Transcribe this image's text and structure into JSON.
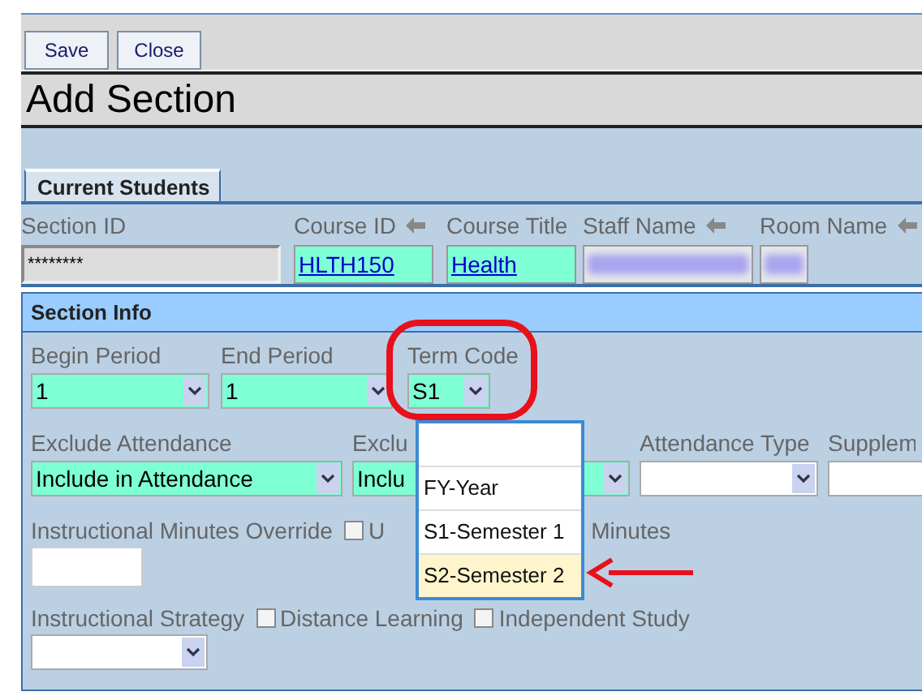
{
  "toolbar": {
    "buttons": [
      "Save",
      "Close"
    ]
  },
  "title": "Add Section",
  "tabs": [
    {
      "label": "Current Students",
      "selected": true
    }
  ],
  "header_fields": [
    {
      "label": "Section ID",
      "kind": "text",
      "value": "********",
      "arrow": false
    },
    {
      "label": "Course ID",
      "kind": "link",
      "value": "HLTH150",
      "arrow": true
    },
    {
      "label": "Course Title",
      "kind": "link",
      "value": "Health",
      "arrow": false
    },
    {
      "label": "Staff Name",
      "kind": "blurred",
      "arrow": true
    },
    {
      "label": "Room Name",
      "kind": "blurred",
      "arrow": true
    }
  ],
  "section": {
    "title": "Section Info",
    "row_1": [
      {
        "label": "Begin Period",
        "kind": "select",
        "value": "1",
        "required": true
      },
      {
        "label": "End Period",
        "kind": "select",
        "value": "1",
        "required": true
      },
      {
        "label": "Term Code",
        "kind": "select",
        "value": "S1",
        "required": true
      }
    ],
    "row_2": [
      {
        "label": "Exclude Attendance",
        "kind": "select",
        "value": "Include in Attendance",
        "required": true
      },
      {
        "label": "Exclu",
        "kind": "select",
        "value": "Inclu",
        "required": true
      },
      {
        "label": "Attendance Type",
        "kind": "select",
        "required": false
      },
      {
        "label": "Supplem",
        "kind": "text",
        "required": false
      }
    ],
    "minutes": {
      "label": "Instructional Minutes Override",
      "checkbox": {
        "label": "U",
        "checked": false
      },
      "trailing": "Minutes"
    },
    "strategy": {
      "label": "Instructional Strategy",
      "checkboxes": [
        {
          "label": "Distance Learning",
          "checked": false
        },
        {
          "label": "Independent Study",
          "checked": false
        }
      ]
    },
    "term_dropdown": {
      "options": [
        {
          "selected": false
        },
        {
          "label": "FY-Year",
          "selected": false
        },
        {
          "label": "S1-Semester 1",
          "selected": false
        },
        {
          "label": "S2-Semester 2",
          "selected": true
        }
      ]
    }
  }
}
